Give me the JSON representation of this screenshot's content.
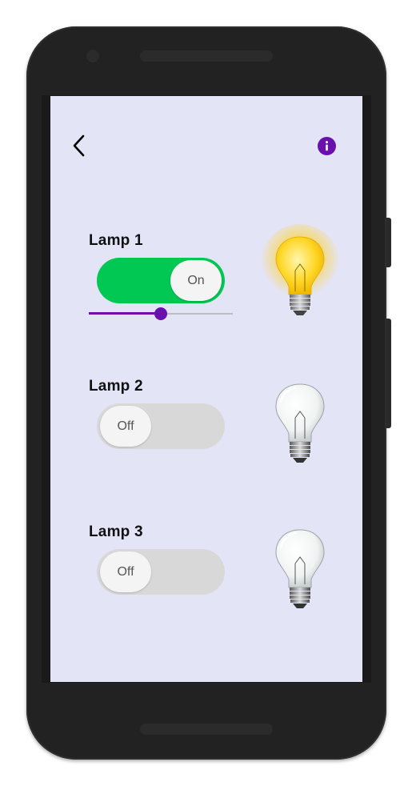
{
  "colors": {
    "screen_bg": "#e4e4f7",
    "accent": "#6a10ad",
    "toggle_on": "#00c853",
    "toggle_off": "#d8d8d8"
  },
  "header": {
    "back_icon": "chevron-left-icon",
    "info_icon": "info-icon"
  },
  "lamps": [
    {
      "label": "Lamp 1",
      "state": "on",
      "toggle_text": "On",
      "brightness": 0.5,
      "bulb": "lit"
    },
    {
      "label": "Lamp 2",
      "state": "off",
      "toggle_text": "Off",
      "bulb": "unlit"
    },
    {
      "label": "Lamp 3",
      "state": "off",
      "toggle_text": "Off",
      "bulb": "unlit"
    }
  ]
}
